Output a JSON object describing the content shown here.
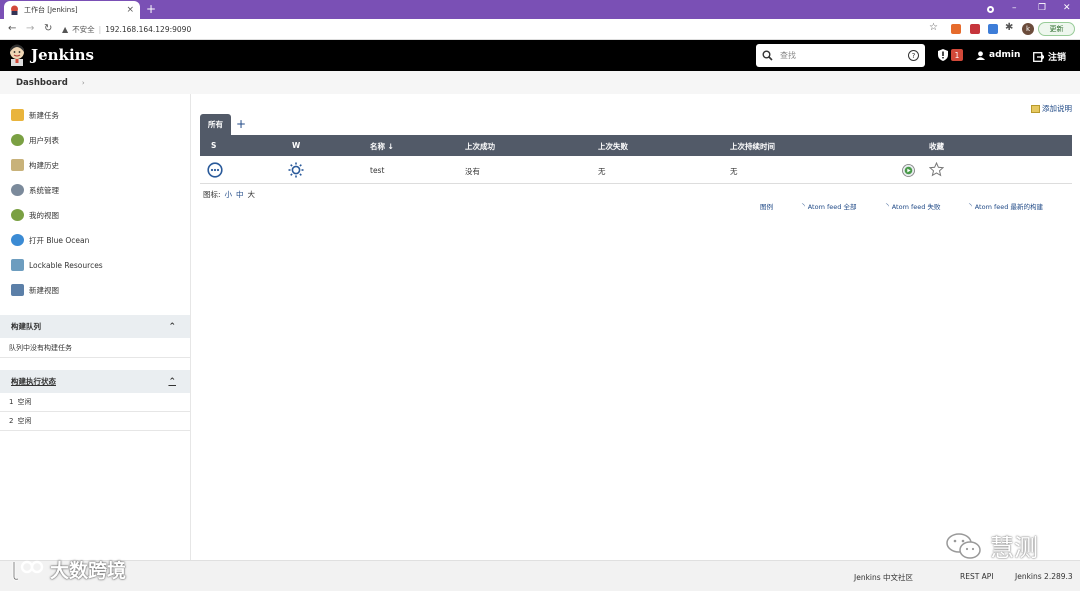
{
  "browser": {
    "tab_title": "工作台 [Jenkins]",
    "tab_close": "×",
    "new_tab": "+",
    "security_label": "不安全",
    "url": "192.168.164.129:9090",
    "update_label": "更新",
    "profile_initial": "k"
  },
  "header": {
    "app_name": "Jenkins",
    "search_placeholder": "查找",
    "help_label": "?",
    "security_count": "1",
    "user_name": "admin",
    "logout_label": "注销"
  },
  "breadcrumb": {
    "items": [
      "Dashboard"
    ]
  },
  "sidebar": {
    "items": [
      {
        "label": "新建任务",
        "color": "#e9b43c"
      },
      {
        "label": "用户列表",
        "color": "#7aa043"
      },
      {
        "label": "构建历史",
        "color": "#c8b27a"
      },
      {
        "label": "系统管理",
        "color": "#7b8a9b"
      },
      {
        "label": "我的视图",
        "color": "#7aa043"
      },
      {
        "label": "打开 Blue Ocean",
        "color": "#3b8bd4"
      },
      {
        "label": "Lockable Resources",
        "color": "#6d9dbf"
      },
      {
        "label": "新建视图",
        "color": "#5b7fa8"
      }
    ],
    "build_queue": {
      "title": "构建队列",
      "empty_text": "队列中没有构建任务"
    },
    "executors": {
      "title": "构建执行状态",
      "rows": [
        {
          "num": "1",
          "status": "空闲"
        },
        {
          "num": "2",
          "status": "空闲"
        }
      ]
    }
  },
  "main": {
    "add_description": "添加说明",
    "view_tab": "所有",
    "add_view": "+",
    "table": {
      "headers": [
        "S",
        "W",
        "名称 ↓",
        "上次成功",
        "上次失败",
        "上次持续时间",
        "收藏"
      ],
      "rows": [
        {
          "name": "test",
          "last_success": "没有",
          "last_failure": "无",
          "last_duration": "无"
        }
      ]
    },
    "icon_label": "图标:",
    "icon_sizes": [
      "小",
      "中",
      "大"
    ],
    "legend": "图例",
    "feeds": [
      "Atom feed 全部",
      "Atom feed 失败",
      "Atom feed 最新的构建"
    ]
  },
  "footer": {
    "community": "Jenkins 中文社区",
    "rest_api": "REST API",
    "version": "Jenkins 2.289.3"
  },
  "watermarks": {
    "left": "大数跨境",
    "right": "慧测"
  },
  "colors": {
    "browser_tabbar": "#7a50b5",
    "header_bg": "#000000",
    "table_header_bg": "#525a68",
    "link": "#204a87",
    "badge": "#d24939"
  }
}
